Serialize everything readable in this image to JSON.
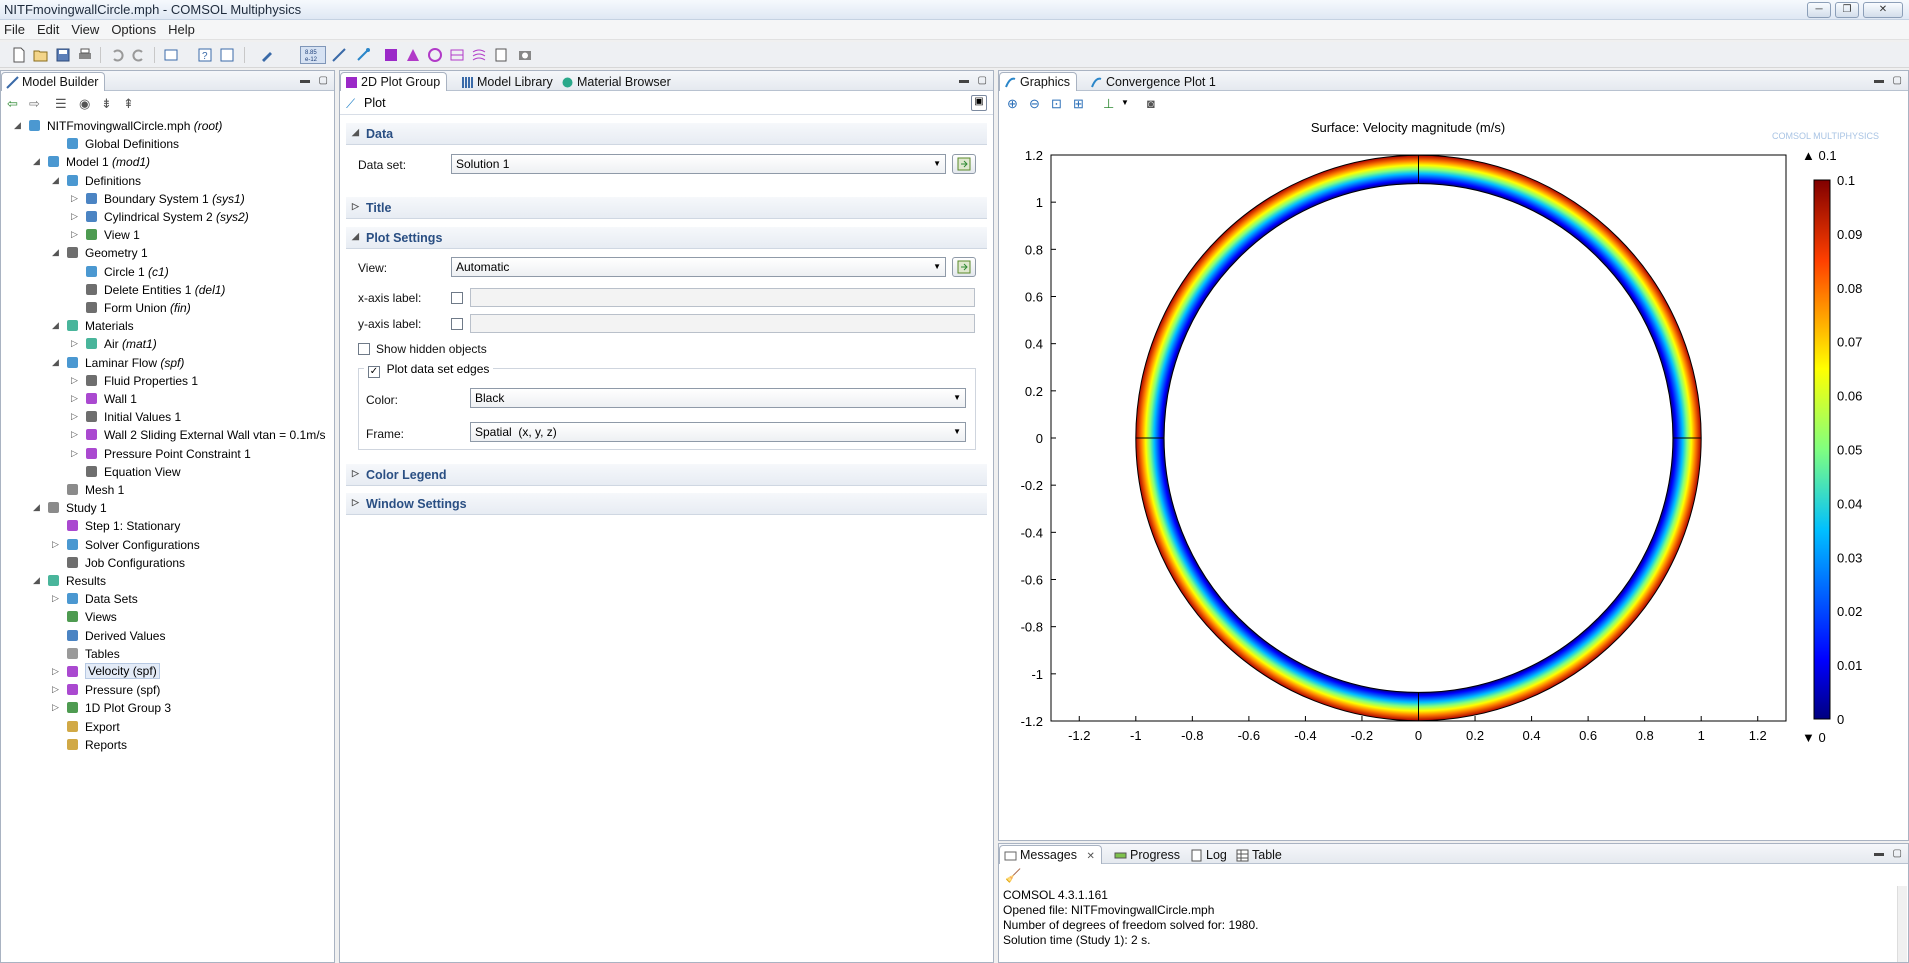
{
  "window": {
    "title": "NITFmovingwallCircle.mph - COMSOL Multiphysics",
    "controls": [
      "─",
      "❐",
      "✕"
    ]
  },
  "menubar": [
    "File",
    "Edit",
    "View",
    "Options",
    "Help"
  ],
  "model_builder": {
    "tab": "Model Builder",
    "tree": [
      {
        "label": "NITFmovingwallCircle.mph",
        "italic": "(root)",
        "level": 0,
        "toggle": "◢",
        "icon": "root-icon"
      },
      {
        "label": "Global Definitions",
        "italic": "",
        "level": 2,
        "toggle": "",
        "icon": "global-definitions-icon"
      },
      {
        "label": "Model 1",
        "italic": "(mod1)",
        "level": 1,
        "toggle": "◢",
        "icon": "model-icon"
      },
      {
        "label": "Definitions",
        "italic": "",
        "level": 2,
        "toggle": "◢",
        "icon": "definitions-icon"
      },
      {
        "label": "Boundary System 1",
        "italic": "(sys1)",
        "level": 3,
        "toggle": "▷",
        "icon": "coordinate-system-icon"
      },
      {
        "label": "Cylindrical System 2",
        "italic": "(sys2)",
        "level": 3,
        "toggle": "▷",
        "icon": "cylindrical-system-icon"
      },
      {
        "label": "View 1",
        "italic": "",
        "level": 3,
        "toggle": "▷",
        "icon": "view-icon"
      },
      {
        "label": "Geometry 1",
        "italic": "",
        "level": 2,
        "toggle": "◢",
        "icon": "geometry-icon"
      },
      {
        "label": "Circle 1",
        "italic": "(c1)",
        "level": 3,
        "toggle": "",
        "icon": "circle-icon"
      },
      {
        "label": "Delete Entities 1",
        "italic": "(del1)",
        "level": 3,
        "toggle": "",
        "icon": "delete-entities-icon"
      },
      {
        "label": "Form Union",
        "italic": "(fin)",
        "level": 3,
        "toggle": "",
        "icon": "form-union-icon"
      },
      {
        "label": "Materials",
        "italic": "",
        "level": 2,
        "toggle": "◢",
        "icon": "materials-icon"
      },
      {
        "label": "Air",
        "italic": "(mat1)",
        "level": 3,
        "toggle": "▷",
        "icon": "material-icon"
      },
      {
        "label": "Laminar Flow",
        "italic": "(spf)",
        "level": 2,
        "toggle": "◢",
        "icon": "laminar-flow-icon"
      },
      {
        "label": "Fluid Properties 1",
        "italic": "",
        "level": 3,
        "toggle": "▷",
        "icon": "fluid-properties-icon"
      },
      {
        "label": "Wall 1",
        "italic": "",
        "level": 3,
        "toggle": "▷",
        "icon": "wall-icon"
      },
      {
        "label": "Initial Values 1",
        "italic": "",
        "level": 3,
        "toggle": "▷",
        "icon": "initial-values-icon"
      },
      {
        "label": "Wall 2 Sliding External Wall vtan = 0.1m/s",
        "italic": "",
        "level": 3,
        "toggle": "▷",
        "icon": "wall-icon"
      },
      {
        "label": "Pressure Point Constraint 1",
        "italic": "",
        "level": 3,
        "toggle": "▷",
        "icon": "pressure-point-icon"
      },
      {
        "label": "Equation View",
        "italic": "",
        "level": 3,
        "toggle": "",
        "icon": "equation-view-icon"
      },
      {
        "label": "Mesh 1",
        "italic": "",
        "level": 2,
        "toggle": "",
        "icon": "mesh-icon"
      },
      {
        "label": "Study 1",
        "italic": "",
        "level": 1,
        "toggle": "◢",
        "icon": "study-icon"
      },
      {
        "label": "Step 1: Stationary",
        "italic": "",
        "level": 2,
        "toggle": "",
        "icon": "stationary-step-icon"
      },
      {
        "label": "Solver Configurations",
        "italic": "",
        "level": 2,
        "toggle": "▷",
        "icon": "solver-configurations-icon"
      },
      {
        "label": "Job Configurations",
        "italic": "",
        "level": 2,
        "toggle": "",
        "icon": "job-configurations-icon"
      },
      {
        "label": "Results",
        "italic": "",
        "level": 1,
        "toggle": "◢",
        "icon": "results-icon"
      },
      {
        "label": "Data Sets",
        "italic": "",
        "level": 2,
        "toggle": "▷",
        "icon": "data-sets-icon"
      },
      {
        "label": "Views",
        "italic": "",
        "level": 2,
        "toggle": "",
        "icon": "views-icon"
      },
      {
        "label": "Derived Values",
        "italic": "",
        "level": 2,
        "toggle": "",
        "icon": "derived-values-icon"
      },
      {
        "label": "Tables",
        "italic": "",
        "level": 2,
        "toggle": "",
        "icon": "tables-icon"
      },
      {
        "label": "Velocity (spf)",
        "italic": "",
        "level": 2,
        "toggle": "▷",
        "icon": "plot-group-icon",
        "selected": true
      },
      {
        "label": "Pressure (spf)",
        "italic": "",
        "level": 2,
        "toggle": "▷",
        "icon": "plot-group-icon"
      },
      {
        "label": "1D Plot Group 3",
        "italic": "",
        "level": 2,
        "toggle": "▷",
        "icon": "plot-1d-icon"
      },
      {
        "label": "Export",
        "italic": "",
        "level": 2,
        "toggle": "",
        "icon": "export-icon"
      },
      {
        "label": "Reports",
        "italic": "",
        "level": 2,
        "toggle": "",
        "icon": "reports-icon"
      }
    ]
  },
  "settings": {
    "tabs": [
      "2D Plot Group",
      "Model Library",
      "Material Browser"
    ],
    "header": "Plot",
    "sections": {
      "data": "Data",
      "title": "Title",
      "plot_settings": "Plot Settings",
      "color_legend": "Color Legend",
      "window_settings": "Window Settings"
    },
    "data_set_label": "Data set:",
    "data_set_value": "Solution 1",
    "view_label": "View:",
    "view_value": "Automatic",
    "xaxis_label": "x-axis label:",
    "yaxis_label": "y-axis label:",
    "show_hidden": "Show hidden objects",
    "plot_edges": "Plot data set edges",
    "color_label": "Color:",
    "color_value": "Black",
    "frame_label": "Frame:",
    "frame_value": "Spatial  (x, y, z)"
  },
  "graphics": {
    "tabs": [
      "Graphics",
      "Convergence Plot 1"
    ],
    "watermark": "COMSOL MULTIPHYSICS"
  },
  "chart_data": {
    "type": "heatmap",
    "title": "Surface: Velocity magnitude (m/s)",
    "x_ticks": [
      "-1.2",
      "-1",
      "-0.8",
      "-0.6",
      "-0.4",
      "-0.2",
      "0",
      "0.2",
      "0.4",
      "0.6",
      "0.8",
      "1",
      "1.2"
    ],
    "y_ticks": [
      "1.2",
      "1",
      "0.8",
      "0.6",
      "0.4",
      "0.2",
      "0",
      "-0.2",
      "-0.4",
      "-0.6",
      "-0.8",
      "-1",
      "-1.2"
    ],
    "xlim": [
      -1.3,
      1.3
    ],
    "ylim": [
      -1.2,
      1.2
    ],
    "annulus": {
      "inner_radius": 0.9,
      "outer_radius": 1.0,
      "value_inner": 0.0,
      "value_outer": 0.1
    },
    "colorbar": {
      "min": 0,
      "max": 0.1,
      "ticks": [
        "0.1",
        "0.09",
        "0.08",
        "0.07",
        "0.06",
        "0.05",
        "0.04",
        "0.03",
        "0.02",
        "0.01",
        "0"
      ],
      "max_label": "▲ 0.1",
      "min_label": "▼ 0",
      "colormap": "Rainbow"
    }
  },
  "messages": {
    "tabs": [
      "Messages",
      "Progress",
      "Log",
      "Table"
    ],
    "lines": [
      "COMSOL 4.3.1.161",
      "Opened file: NITFmovingwallCircle.mph",
      "Number of degrees of freedom solved for: 1980.",
      "Solution time (Study 1): 2 s."
    ]
  }
}
